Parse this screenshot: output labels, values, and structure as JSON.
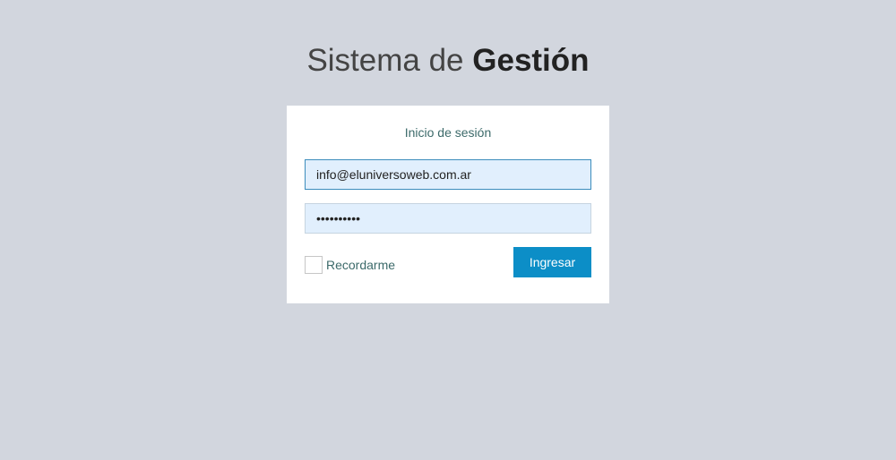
{
  "logo": {
    "light": "Sistema de ",
    "bold": "Gestión"
  },
  "login": {
    "message": "Inicio de sesión",
    "email_value": "info@eluniversoweb.com.ar",
    "password_value": "••••••••••",
    "remember_label": "Recordarme",
    "submit_label": "Ingresar"
  },
  "colors": {
    "background": "#d2d6de",
    "button": "#0c8ec7",
    "input_fill": "#e1effd"
  }
}
